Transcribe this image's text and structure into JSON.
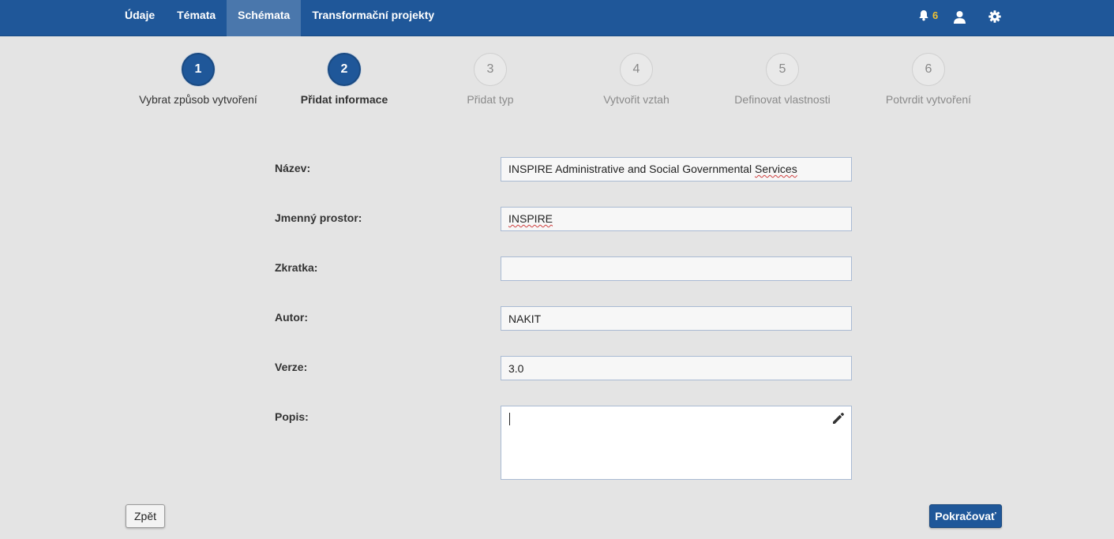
{
  "nav": {
    "items": [
      {
        "label": "Údaje"
      },
      {
        "label": "Témata"
      },
      {
        "label": "Schémata"
      },
      {
        "label": "Transformační projekty"
      }
    ],
    "active_item": "Schémata",
    "notification_count": "6",
    "accent_color": "#1f5799",
    "notification_color": "#f1c232",
    "icons": [
      "bell-icon",
      "user-icon",
      "gear-icon"
    ]
  },
  "stepper": {
    "steps": [
      {
        "number": "1",
        "label": "Vybrat způsob vytvoření",
        "state": "done"
      },
      {
        "number": "2",
        "label": "Přidat informace",
        "state": "current"
      },
      {
        "number": "3",
        "label": "Přidat typ",
        "state": "todo"
      },
      {
        "number": "4",
        "label": "Vytvořit vztah",
        "state": "todo"
      },
      {
        "number": "5",
        "label": "Definovat vlastnosti",
        "state": "todo"
      },
      {
        "number": "6",
        "label": "Potvrdit vytvoření",
        "state": "todo"
      }
    ]
  },
  "form": {
    "name": {
      "label": "Název:",
      "value_main": "INSPIRE Administrative and Social Governmental ",
      "value_flagged": "Services"
    },
    "namespace": {
      "label": "Jmenný prostor:",
      "value": "INSPIRE"
    },
    "abbreviation": {
      "label": "Zkratka:",
      "value": ""
    },
    "author": {
      "label": "Autor:",
      "value": "NAKIT"
    },
    "version": {
      "label": "Verze:",
      "value": "3.0"
    },
    "description": {
      "label": "Popis:",
      "value": ""
    }
  },
  "actions": {
    "back_label": "Zpět",
    "continue_label": "Pokračovať"
  }
}
